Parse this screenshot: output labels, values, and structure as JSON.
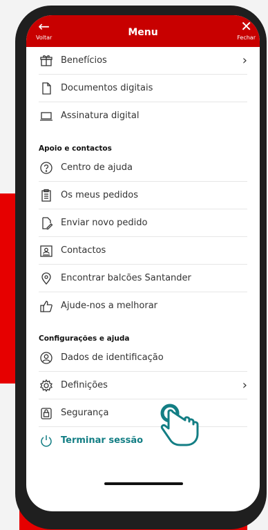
{
  "header": {
    "back_label": "Voltar",
    "title": "Menu",
    "close_label": "Fechar"
  },
  "top_items": [
    {
      "label": "Benefícios",
      "icon": "gift-icon",
      "has_chevron": true
    },
    {
      "label": "Documentos digitais",
      "icon": "document-icon"
    },
    {
      "label": "Assinatura digital",
      "icon": "laptop-icon"
    }
  ],
  "support": {
    "title": "Apoio e contactos",
    "items": [
      {
        "label": "Centro de ajuda",
        "icon": "help-circle-icon"
      },
      {
        "label": "Os meus pedidos",
        "icon": "clipboard-icon"
      },
      {
        "label": "Enviar novo pedido",
        "icon": "edit-document-icon"
      },
      {
        "label": "Contactos",
        "icon": "contact-card-icon"
      },
      {
        "label": "Encontrar balcões Santander",
        "icon": "location-pin-icon"
      },
      {
        "label": "Ajude-nos a melhorar",
        "icon": "thumbs-up-icon"
      }
    ]
  },
  "settings": {
    "title": "Configurações e ajuda",
    "items": [
      {
        "label": "Dados de identificação",
        "icon": "user-circle-icon"
      },
      {
        "label": "Definições",
        "icon": "gear-icon",
        "has_chevron": true
      },
      {
        "label": "Segurança",
        "icon": "lock-icon"
      }
    ]
  },
  "logout_label": "Terminar sessão",
  "colors": {
    "brand_red": "#c80000",
    "accent_teal": "#137e84"
  }
}
